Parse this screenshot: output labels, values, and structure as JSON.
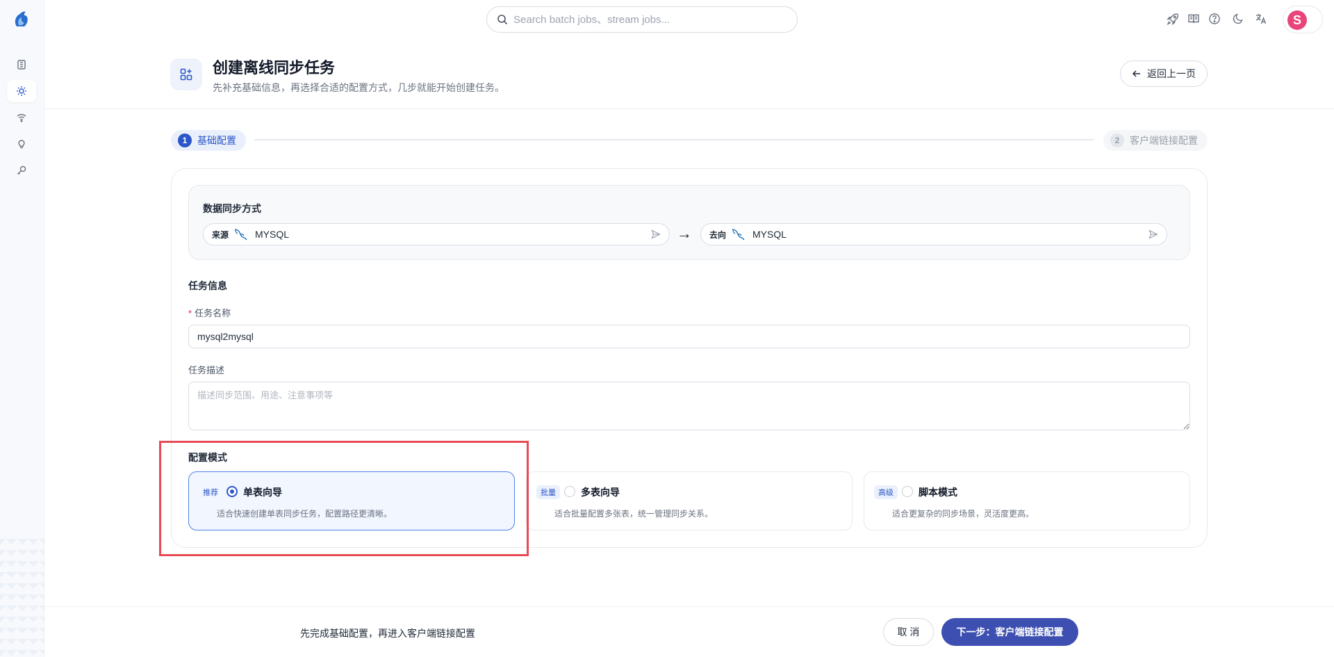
{
  "search": {
    "placeholder": "Search batch jobs、stream jobs..."
  },
  "topbar": {
    "icons": [
      "rocket-icon",
      "book-icon",
      "help-icon",
      "moon-icon",
      "translate-icon"
    ],
    "avatar_letter": "S",
    "avatar_color": "#e8457a"
  },
  "sidebar": {
    "items": [
      {
        "icon": "list-icon",
        "active": false
      },
      {
        "icon": "settings-sun-icon",
        "active": true
      },
      {
        "icon": "wifi-icon",
        "active": false
      },
      {
        "icon": "lightbulb-icon",
        "active": false
      },
      {
        "icon": "key-search-icon",
        "active": false
      }
    ]
  },
  "header": {
    "title": "创建离线同步任务",
    "subtitle": "先补充基础信息，再选择合适的配置方式，几步就能开始创建任务。",
    "back_label": "返回上一页"
  },
  "stepper": {
    "steps": [
      {
        "num": "1",
        "label": "基础配置",
        "active": true
      },
      {
        "num": "2",
        "label": "客户端链接配置",
        "active": false
      }
    ]
  },
  "sync": {
    "title": "数据同步方式",
    "source": {
      "tag": "来源",
      "name": "MYSQL"
    },
    "arrow": "→",
    "target": {
      "tag": "去向",
      "name": "MYSQL"
    }
  },
  "task_info": {
    "title": "任务信息",
    "name_required": "*",
    "name_label": "任务名称",
    "name_value": "mysql2mysql",
    "desc_label": "任务描述",
    "desc_placeholder": "描述同步范围、用途、注意事项等"
  },
  "config_mode": {
    "title": "配置模式",
    "options": [
      {
        "badge": "推荐",
        "title": "单表向导",
        "desc": "适合快速创建单表同步任务，配置路径更清晰。",
        "selected": true
      },
      {
        "badge": "批量",
        "title": "多表向导",
        "desc": "适合批量配置多张表，统一管理同步关系。",
        "selected": false
      },
      {
        "badge": "高级",
        "title": "脚本模式",
        "desc": "适合更复杂的同步场景，灵活度更高。",
        "selected": false
      }
    ]
  },
  "footer": {
    "hint": "先完成基础配置，再进入客户端链接配置",
    "cancel_label": "取 消",
    "next_label": "下一步：客户端链接配置"
  },
  "colors": {
    "accent": "#2b56c9",
    "primary_button": "#3d4fb0",
    "highlight_box": "#e84a55"
  }
}
